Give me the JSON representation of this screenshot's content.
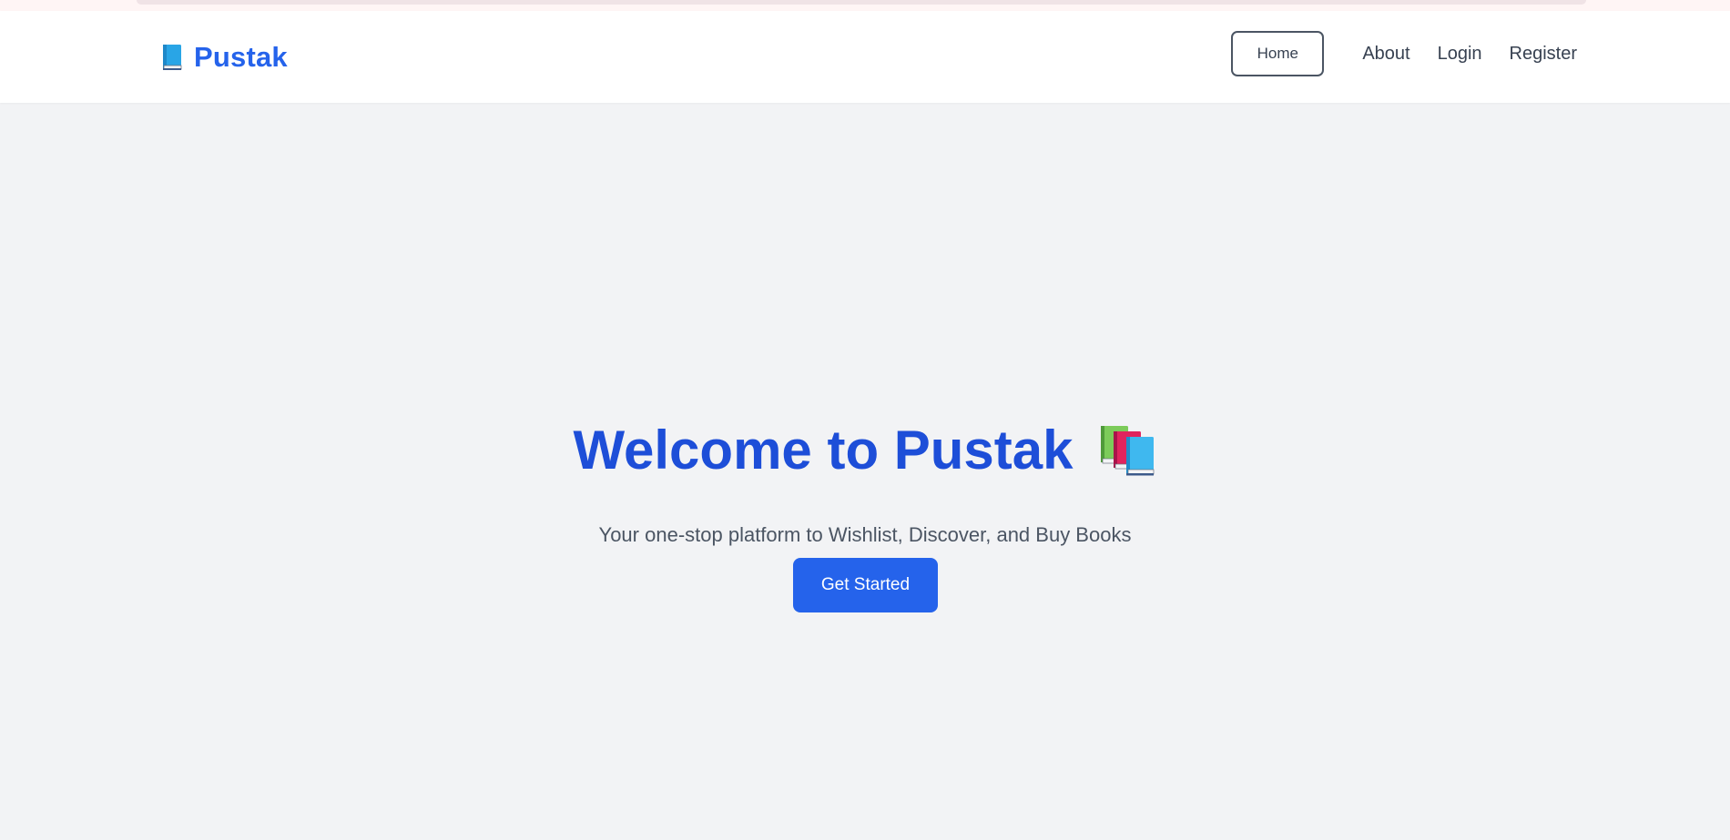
{
  "brand": {
    "name": "Pustak",
    "icon": "blue-book-icon",
    "color": "#2563eb"
  },
  "nav": {
    "items": [
      {
        "label": "Home",
        "active": true
      },
      {
        "label": "About",
        "active": false
      },
      {
        "label": "Login",
        "active": false
      },
      {
        "label": "Register",
        "active": false
      }
    ]
  },
  "hero": {
    "title": "Welcome to Pustak",
    "title_icon": "books-icon",
    "subtitle": "Your one-stop platform to Wishlist, Discover, and Buy Books",
    "cta_label": "Get Started"
  },
  "colors": {
    "accent": "#2563eb",
    "title": "#1d4ed8",
    "background": "#f2f3f5"
  }
}
